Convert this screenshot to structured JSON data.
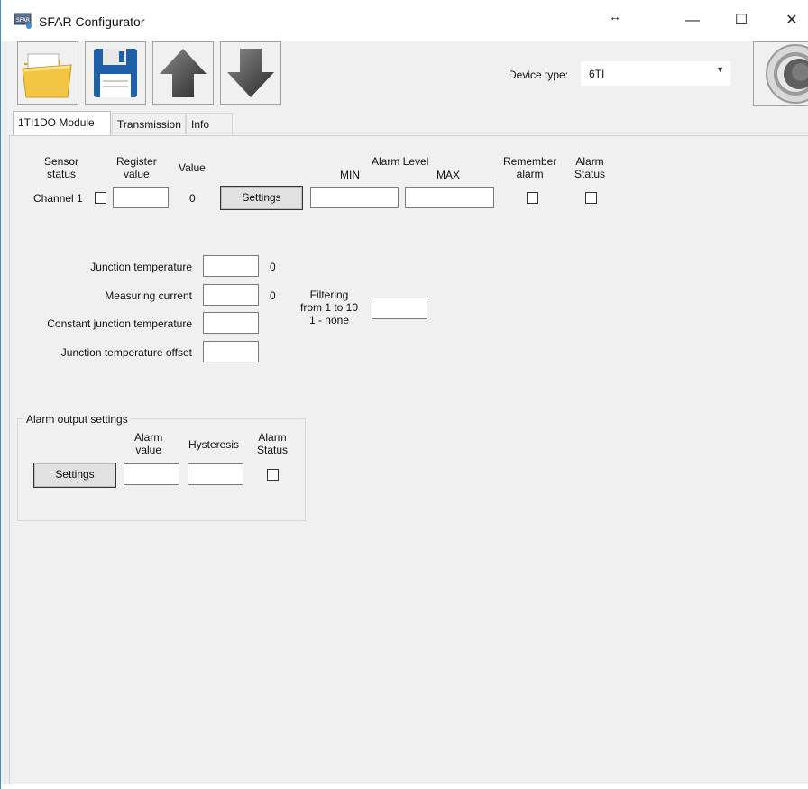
{
  "window": {
    "title": "SFAR Configurator",
    "resize_glyph": "↔",
    "minimize_glyph": "—",
    "maximize_glyph": "☐",
    "close_glyph": "✕",
    "app_icon": "sfar-app-icon"
  },
  "toolbar": {
    "buttons": [
      {
        "icon": "open-folder-icon"
      },
      {
        "icon": "save-floppy-icon"
      },
      {
        "icon": "upload-arrow-up-icon"
      },
      {
        "icon": "download-arrow-down-icon"
      }
    ],
    "device_type_label": "Device type:",
    "device_type_value": "6TI",
    "dropdown_glyph": "▼",
    "connect_icon": "connect-ring-icon"
  },
  "tabs": [
    {
      "label": "1TI1DO Module",
      "active": true
    },
    {
      "label": "Transmission",
      "active": false
    },
    {
      "label": "Info",
      "active": false
    }
  ],
  "channel_section": {
    "headers": {
      "sensor_status": "Sensor\nstatus",
      "register_value": "Register\nvalue",
      "value": "Value",
      "alarm_level": "Alarm Level",
      "min": "MIN",
      "max": "MAX",
      "remember_alarm": "Remember\nalarm",
      "alarm_status": "Alarm\nStatus"
    },
    "channel_label": "Channel 1",
    "value": "0",
    "settings_button": "Settings",
    "register_value": "",
    "min_value": "",
    "max_value": ""
  },
  "junction_section": {
    "junction_temperature_label": "Junction temperature",
    "junction_temperature_value": "0",
    "measuring_current_label": "Measuring current",
    "measuring_current_value": "0",
    "constant_junction_label": "Constant junction temperature",
    "junction_offset_label": "Junction temperature offset",
    "filtering_label": "Filtering\nfrom 1 to 10\n1 - none"
  },
  "alarm_output": {
    "group_title": "Alarm output settings",
    "alarm_value_header": "Alarm\nvalue",
    "hysteresis_header": "Hysteresis",
    "alarm_status_header": "Alarm\nStatus",
    "settings_button": "Settings"
  },
  "colors": {
    "window_border": "#3c8ee0",
    "background": "#f0f0f0",
    "folder_yellow": "#f2c542",
    "floppy_blue": "#1f5fa8"
  }
}
